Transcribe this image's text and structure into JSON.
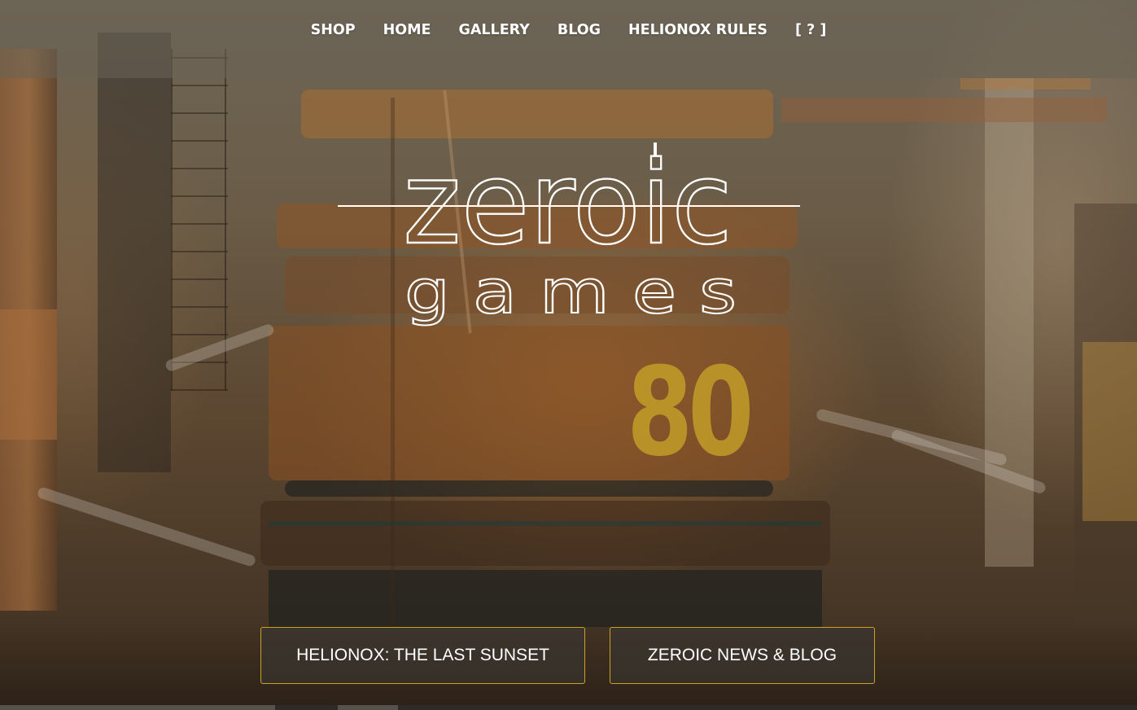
{
  "nav": {
    "items": [
      {
        "label": "SHOP"
      },
      {
        "label": "HOME"
      },
      {
        "label": "GALLERY"
      },
      {
        "label": "BLOG"
      },
      {
        "label": "HELIONOX RULES"
      },
      {
        "label": "[ ? ]"
      }
    ]
  },
  "logo": {
    "line1": "zeroic",
    "line2": "g a m e s"
  },
  "hero": {
    "background_number": "80"
  },
  "cta": {
    "primary_label": "HELIONOX: THE LAST SUNSET",
    "secondary_label": "ZEROIC NEWS & BLOG"
  },
  "colors": {
    "cta_border": "#c9a227",
    "nav_text": "#ffffff"
  }
}
